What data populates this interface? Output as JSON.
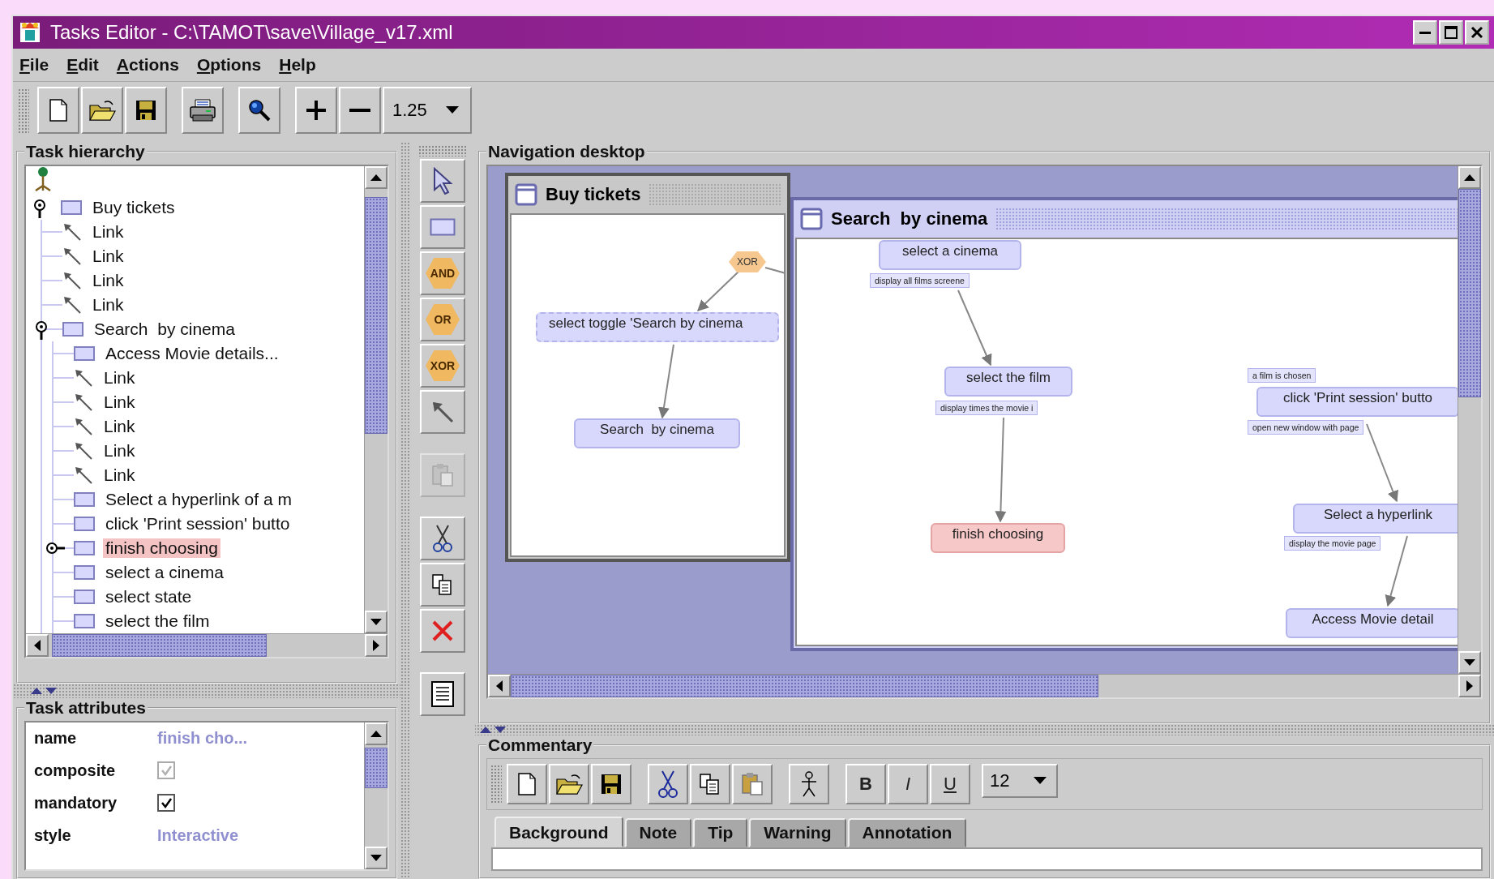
{
  "window": {
    "title": "Tasks Editor - C:\\TAMOT\\save\\Village_v17.xml"
  },
  "menu": [
    "File",
    "Edit",
    "Actions",
    "Options",
    "Help"
  ],
  "toolbar": {
    "zoom": "1.25"
  },
  "task_hierarchy": {
    "title": "Task hierarchy",
    "tree": [
      {
        "label": "Buy tickets",
        "kind": "task",
        "expanded": true,
        "selected": false,
        "children": [
          {
            "label": "Link",
            "kind": "link",
            "selected": false
          },
          {
            "label": "Link",
            "kind": "link",
            "selected": false
          },
          {
            "label": "Link",
            "kind": "link",
            "selected": false
          },
          {
            "label": "Link",
            "kind": "link",
            "selected": false
          },
          {
            "label": "Search  by cinema",
            "kind": "task",
            "expanded": true,
            "selected": false,
            "children": [
              {
                "label": "Access Movie details...",
                "kind": "task",
                "selected": false
              },
              {
                "label": "Link",
                "kind": "link",
                "selected": false
              },
              {
                "label": "Link",
                "kind": "link",
                "selected": false
              },
              {
                "label": "Link",
                "kind": "link",
                "selected": false
              },
              {
                "label": "Link",
                "kind": "link",
                "selected": false
              },
              {
                "label": "Link",
                "kind": "link",
                "selected": false
              },
              {
                "label": "Select a hyperlink of a m",
                "kind": "task",
                "selected": false
              },
              {
                "label": "click 'Print session' butto",
                "kind": "task",
                "selected": false
              },
              {
                "label": "finish choosing",
                "kind": "task",
                "expanded": false,
                "selected": true
              },
              {
                "label": "select a cinema",
                "kind": "task",
                "selected": false
              },
              {
                "label": "select state",
                "kind": "task",
                "selected": false
              },
              {
                "label": "select the film",
                "kind": "task",
                "selected": false
              }
            ]
          }
        ]
      }
    ]
  },
  "task_attributes": {
    "title": "Task attributes",
    "rows": [
      {
        "label": "name",
        "kind": "text",
        "value": "finish cho..."
      },
      {
        "label": "composite",
        "kind": "checkbox",
        "checked": true,
        "disabled": true
      },
      {
        "label": "mandatory",
        "kind": "checkbox",
        "checked": true,
        "disabled": false
      },
      {
        "label": "style",
        "kind": "text",
        "value": "Interactive"
      }
    ]
  },
  "palette": [
    {
      "kind": "pointer",
      "disabled": false
    },
    {
      "kind": "task",
      "disabled": false
    },
    {
      "kind": "operator",
      "label": "AND",
      "disabled": false
    },
    {
      "kind": "operator",
      "label": "OR",
      "disabled": false
    },
    {
      "kind": "operator",
      "label": "XOR",
      "disabled": false
    },
    {
      "kind": "link",
      "disabled": false
    },
    {
      "kind": "paste",
      "disabled": true
    },
    {
      "kind": "cut",
      "disabled": false
    },
    {
      "kind": "copy",
      "disabled": false
    },
    {
      "kind": "delete",
      "disabled": false
    },
    {
      "kind": "notes",
      "disabled": false
    }
  ],
  "navigation_desktop": {
    "title": "Navigation desktop",
    "windows": [
      {
        "title": "Buy tickets",
        "active": false,
        "nodes": [
          {
            "label": "XOR",
            "kind": "operator",
            "selected": false
          },
          {
            "label": "select toggle 'Search by cinema",
            "kind": "optional",
            "selected": false
          },
          {
            "label": "Search  by cinema",
            "kind": "task",
            "selected": false
          }
        ]
      },
      {
        "title": "Search  by cinema",
        "active": true,
        "nodes": [
          {
            "label": "select a cinema",
            "kind": "task",
            "selected": false
          },
          {
            "label": "display all films screene",
            "kind": "condition",
            "selected": false
          },
          {
            "label": "select the film",
            "kind": "task",
            "selected": false
          },
          {
            "label": "display times the movie i",
            "kind": "condition",
            "selected": false
          },
          {
            "label": "finish choosing",
            "kind": "task",
            "selected": true
          },
          {
            "label": "a film is chosen",
            "kind": "condition",
            "selected": false
          },
          {
            "label": "click 'Print session' butto",
            "kind": "task",
            "selected": false
          },
          {
            "label": "open new window with page",
            "kind": "condition",
            "selected": false
          },
          {
            "label": "Select a hyperlink",
            "kind": "task",
            "selected": false
          },
          {
            "label": "display the movie page",
            "kind": "condition",
            "selected": false
          },
          {
            "label": "Access Movie detail",
            "kind": "task",
            "selected": false
          }
        ]
      }
    ]
  },
  "commentary": {
    "title": "Commentary",
    "format_buttons": [
      "B",
      "I",
      "U"
    ],
    "font_size": "12",
    "tabs": [
      {
        "label": "Background",
        "selected": true
      },
      {
        "label": "Note",
        "selected": false
      },
      {
        "label": "Tip",
        "selected": false
      },
      {
        "label": "Warning",
        "selected": false
      },
      {
        "label": "Annotation",
        "selected": false
      }
    ]
  }
}
